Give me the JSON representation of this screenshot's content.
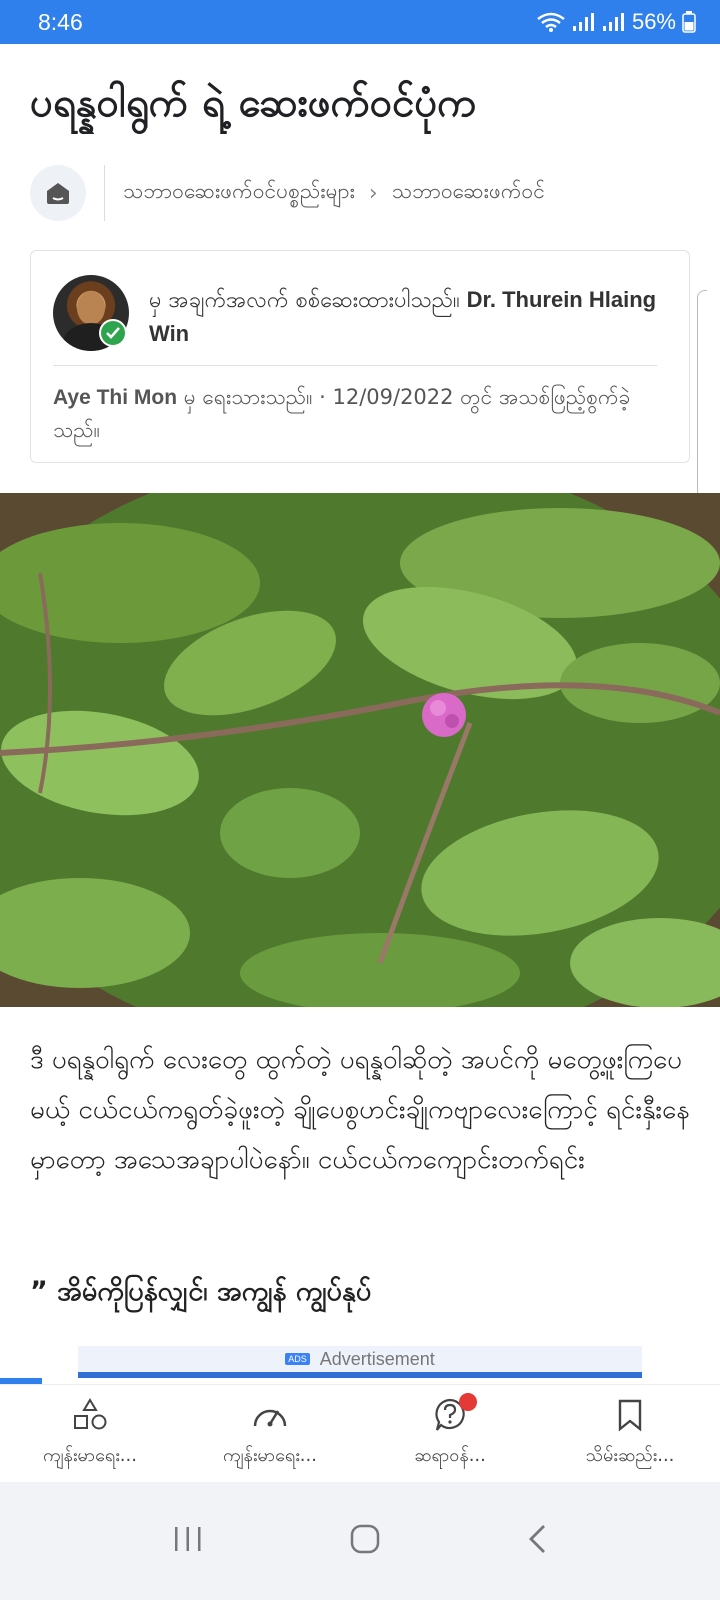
{
  "status_bar": {
    "time": "8:46",
    "battery": "56%"
  },
  "article": {
    "title": "ပရန္နဝါရွက် ရဲ့ ဆေးဖက်ဝင်ပုံက",
    "breadcrumb": {
      "level1": "သဘာဝဆေးဖက်ဝင်ပစ္စည်းများ",
      "level2": "သဘာဝဆေးဖက်ဝင်"
    },
    "review_card": {
      "reviewer_prefix": "မှ အချက်အလက် စစ်ဆေးထားပါသည်။",
      "reviewer_name": "Dr. Thurein Hlaing Win",
      "author_name": "Aye Thi Mon",
      "author_suffix": "မှ ရေးသားသည်။ · 12/09/2022 တွင် အသစ်ဖြည့်စွက်ခဲ့သည်။"
    },
    "body_text": "ဒီ ပရန္နဝါရွက် လေးတွေ ထွက်တဲ့ ပရန္နဝါဆိုတဲ့ အပင်ကို မတွေ့ဖူးကြပေမယ့် ငယ်ငယ်ကရွတ်ခဲ့ဖူးတဲ့ ချိုပေစွဟင်းချိုကဗျာလေးကြောင့် ရင်းနှီးနေမှာတော့ အသေအချာပါပဲနော်။ ငယ်ငယ်ကကျောင်းတက်ရင်း",
    "quote": "” အိမ်ကိုပြန်လျှင်၊ အကျွန် ကျွပ်နုပ်"
  },
  "ad": {
    "chip": "ADS",
    "label": "Advertisement"
  },
  "bottom_nav": {
    "items": [
      {
        "label": "ကျန်းမာရေး...",
        "icon": "shapes-icon"
      },
      {
        "label": "ကျန်းမာရေး...",
        "icon": "gauge-icon"
      },
      {
        "label": "ဆရာဝန်...",
        "icon": "question-icon"
      },
      {
        "label": "သိမ်းဆည်း...",
        "icon": "bookmark-icon"
      }
    ]
  },
  "colors": {
    "accent": "#2f80ed",
    "verified": "#2ea44f",
    "notification": "#e53935"
  }
}
